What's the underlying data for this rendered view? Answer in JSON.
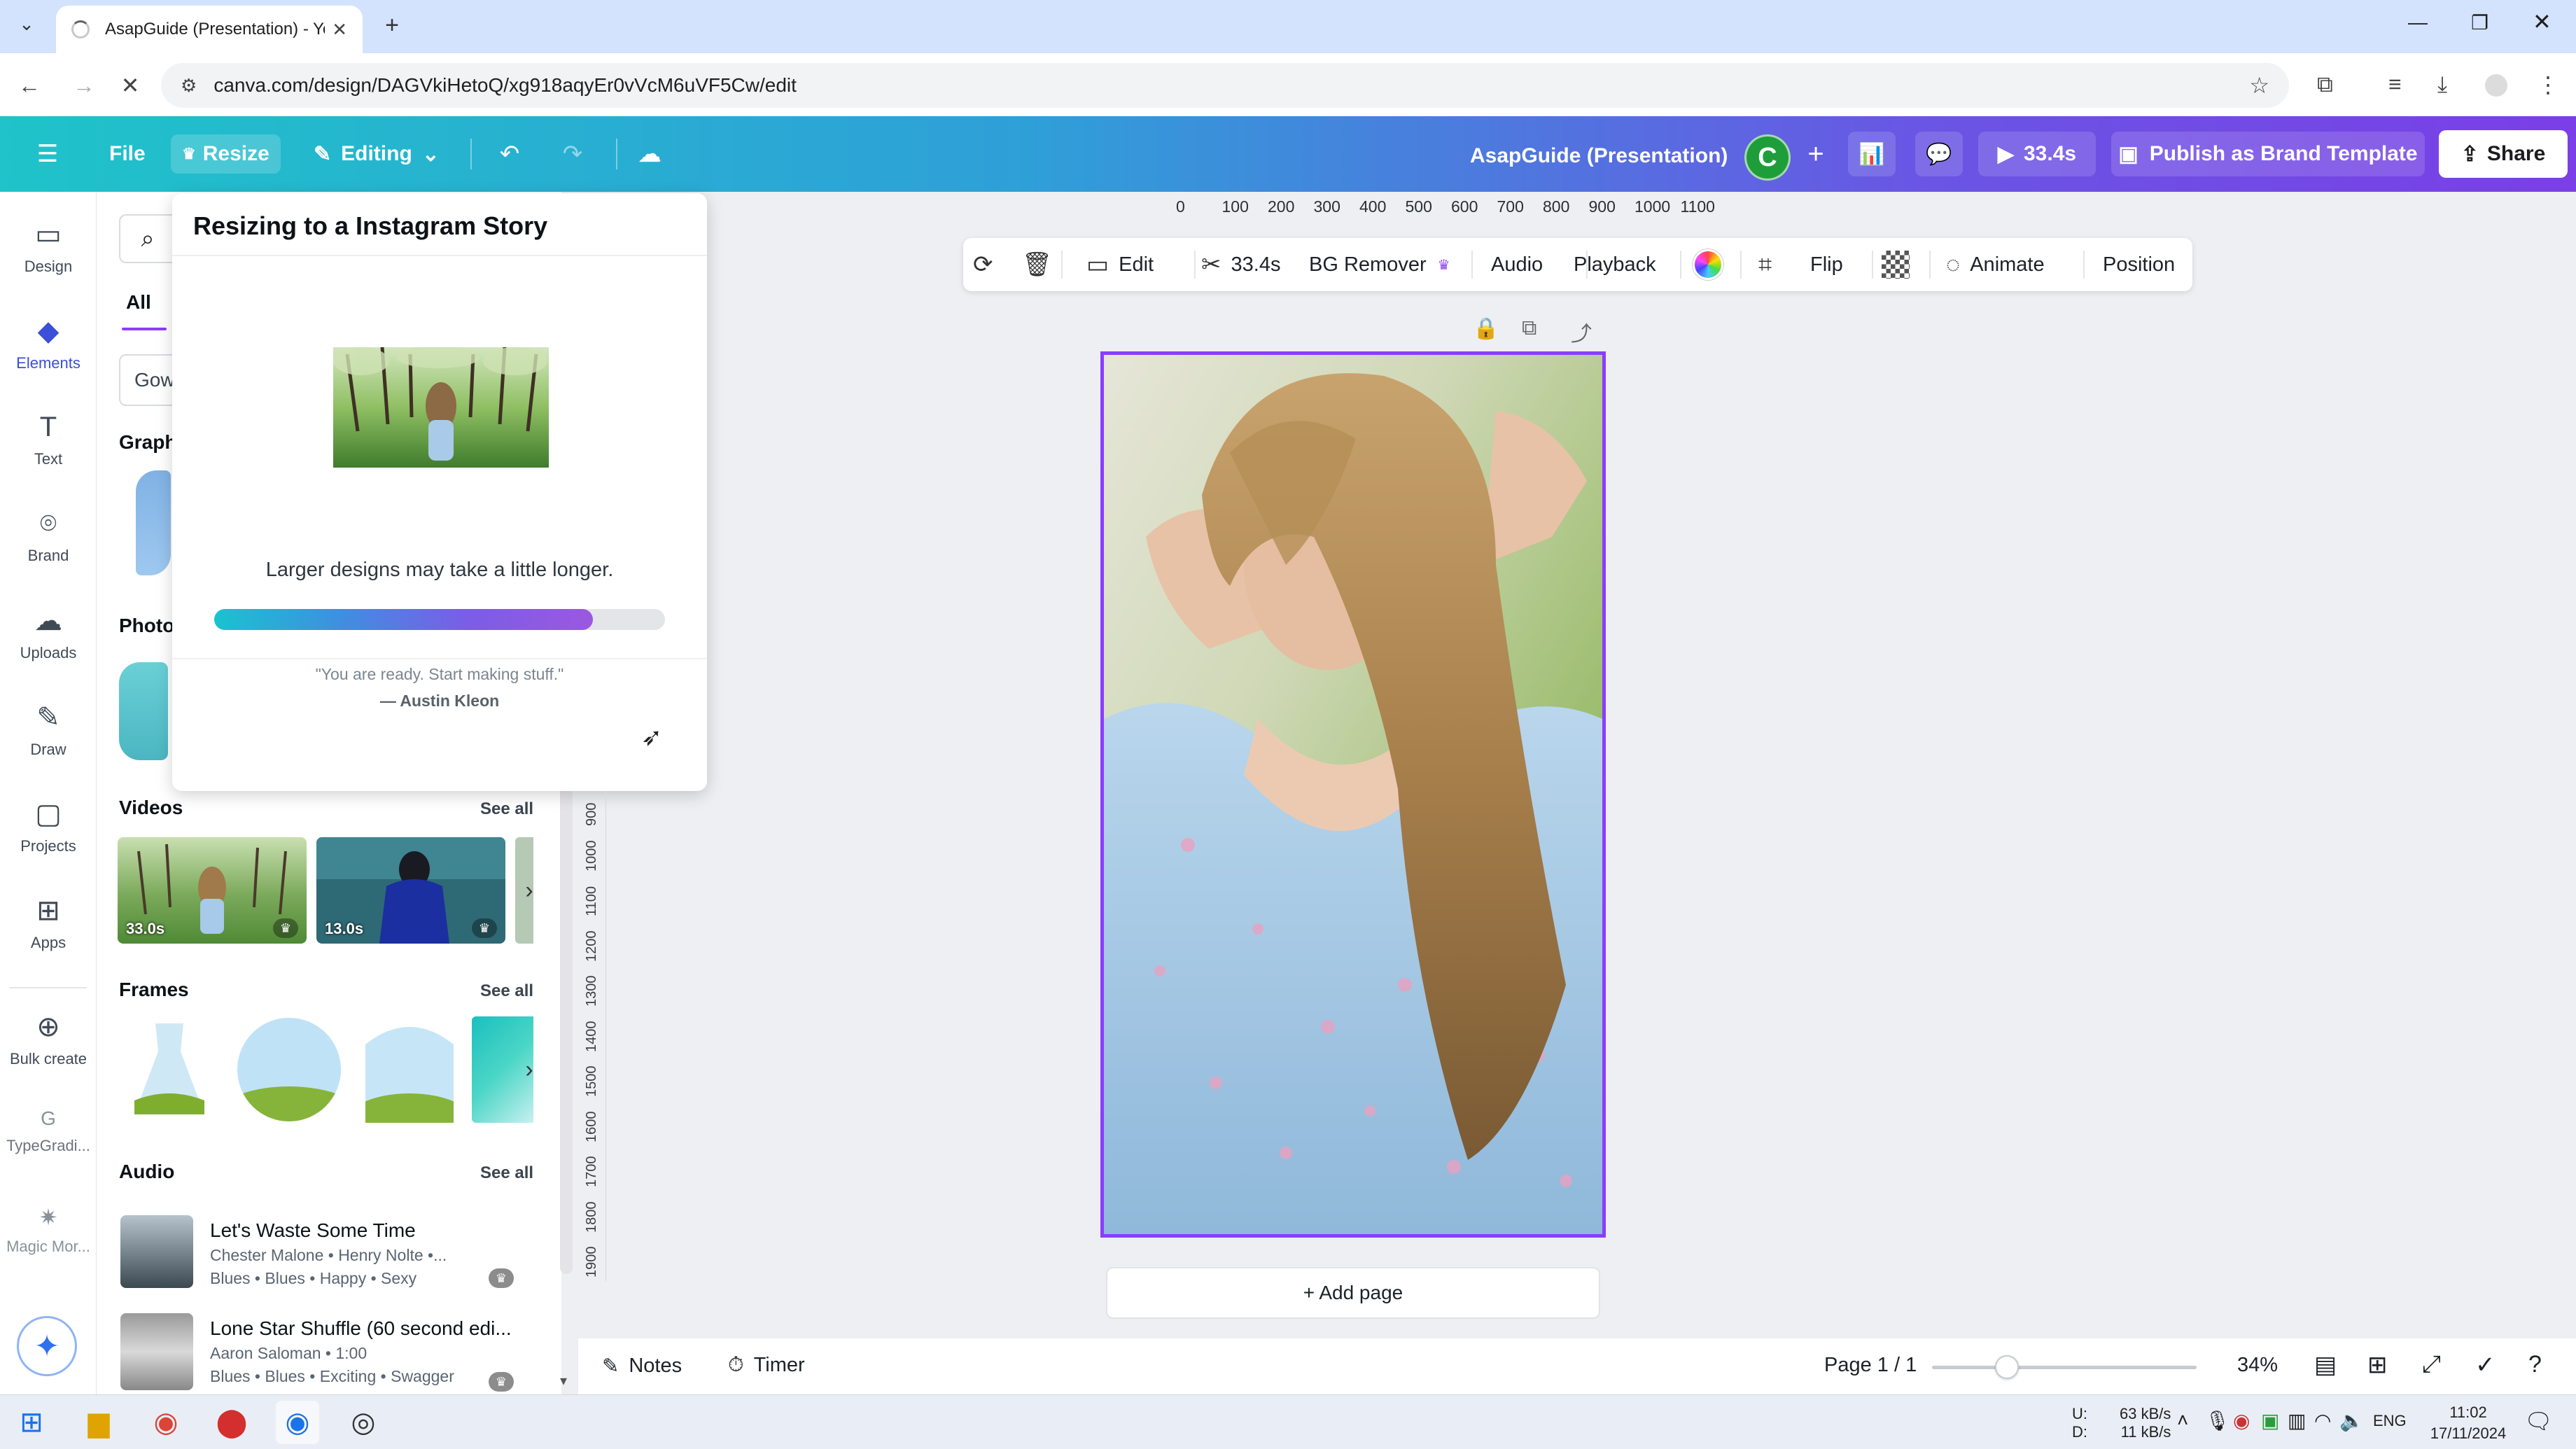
{
  "browser": {
    "tab_title": "AsapGuide (Presentation) - You",
    "url": "canva.com/design/DAGVkiHetoQ/xg918aqyEr0vVcM6uVF5Cw/edit"
  },
  "header": {
    "file": "File",
    "resize": "Resize",
    "editing": "Editing",
    "doc_title": "AsapGuide (Presentation)",
    "avatar_letter": "C",
    "play_duration": "33.4s",
    "publish": "Publish as Brand Template",
    "share": "Share"
  },
  "rail": {
    "items": [
      {
        "label": "Design",
        "icon": "design-icon"
      },
      {
        "label": "Elements",
        "icon": "elements-icon"
      },
      {
        "label": "Text",
        "icon": "text-icon"
      },
      {
        "label": "Brand",
        "icon": "brand-icon"
      },
      {
        "label": "Uploads",
        "icon": "uploads-icon"
      },
      {
        "label": "Draw",
        "icon": "draw-icon"
      },
      {
        "label": "Projects",
        "icon": "projects-icon"
      },
      {
        "label": "Apps",
        "icon": "apps-icon"
      },
      {
        "label": "Bulk create",
        "icon": "bulk-create-icon"
      },
      {
        "label": "TypeGradi...",
        "icon": "typegradient-icon"
      },
      {
        "label": "Magic Mor...",
        "icon": "magic-morph-icon"
      }
    ]
  },
  "panel": {
    "tab_all": "All",
    "search_value": "Gow",
    "graphics_title": "Graph",
    "photos_title": "Photo",
    "videos": {
      "title": "Videos",
      "see_all": "See all",
      "items": [
        {
          "duration": "33.0s"
        },
        {
          "duration": "13.0s"
        }
      ]
    },
    "frames": {
      "title": "Frames",
      "see_all": "See all"
    },
    "audio": {
      "title": "Audio",
      "see_all": "See all",
      "items": [
        {
          "title": "Let's Waste Some Time",
          "artist": "Chester Malone • Henry Nolte •...",
          "tags": "Blues • Blues • Happy • Sexy"
        },
        {
          "title": "Lone Star Shuffle (60 second edi...",
          "artist": "Aaron Saloman • 1:00",
          "tags": "Blues • Blues • Exciting • Swagger"
        }
      ]
    }
  },
  "popover": {
    "title": "Resizing to a Instagram Story",
    "message": "Larger designs may take a little longer.",
    "progress": 0.84,
    "quote": "\"You are ready. Start making stuff.\"",
    "author": "— Austin Kleon"
  },
  "ruler": {
    "top": [
      "0",
      "100",
      "200",
      "300",
      "400",
      "500",
      "600",
      "700",
      "800",
      "900",
      "1000",
      "1100"
    ],
    "left": [
      "900",
      "1000",
      "1100",
      "1200",
      "1300",
      "1400",
      "1500",
      "1600",
      "1700",
      "1800",
      "1900"
    ]
  },
  "toolbar": {
    "edit": "Edit",
    "duration": "33.4s",
    "bg_remover": "BG Remover",
    "audio": "Audio",
    "playback": "Playback",
    "flip": "Flip",
    "animate": "Animate",
    "position": "Position"
  },
  "canvas": {
    "add_page": "+ Add page"
  },
  "bottom": {
    "notes": "Notes",
    "timer": "Timer",
    "page": "Page 1 / 1",
    "zoom": "34%",
    "zoom_level": 0.34
  },
  "taskbar": {
    "net_up": "63 kB/s",
    "net_down": "11 kB/s",
    "net_u": "U:",
    "net_d": "D:",
    "lang": "ENG",
    "time": "11:02",
    "date": "17/11/2024"
  },
  "colors": {
    "accent": "#8b3dff",
    "header_start": "#1fc3c9",
    "header_end": "#7a3fe6",
    "avatar": "#1e9e3a"
  }
}
